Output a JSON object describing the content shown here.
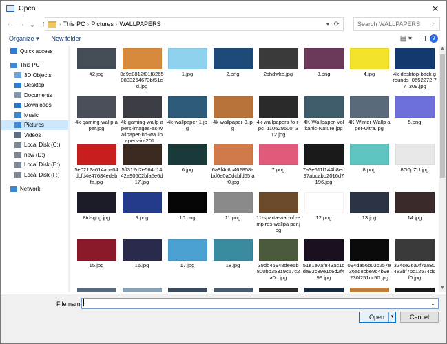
{
  "window": {
    "title": "Open",
    "close_glyph": "✕"
  },
  "nav": {
    "back": "←",
    "forward": "→",
    "recent": "⌄",
    "up": "↑"
  },
  "breadcrumb": [
    "This PC",
    "Pictures",
    "WALLPAPERS"
  ],
  "breadcrumb_sep": "›",
  "search": {
    "placeholder": "Search WALLPAPERS"
  },
  "toolbar": {
    "organize": "Organize ▾",
    "new_folder": "New folder",
    "view_glyph": "▤ ▾",
    "help_glyph": "?"
  },
  "sidebar": [
    {
      "label": "Quick access",
      "icon": "star-icon",
      "color": "#2f7bd4"
    },
    {
      "label": "This PC",
      "icon": "computer-icon",
      "color": "#3c8ad8",
      "gap": true
    },
    {
      "label": "3D Objects",
      "icon": "cube-icon",
      "color": "#66a6e2",
      "indent": true
    },
    {
      "label": "Desktop",
      "icon": "desktop-icon",
      "color": "#2c7fd0",
      "indent": true
    },
    {
      "label": "Documents",
      "icon": "document-icon",
      "color": "#7f96ad",
      "indent": true
    },
    {
      "label": "Downloads",
      "icon": "download-icon",
      "color": "#2a73c8",
      "indent": true
    },
    {
      "label": "Music",
      "icon": "music-icon",
      "color": "#3a86d0",
      "indent": true
    },
    {
      "label": "Pictures",
      "icon": "picture-icon",
      "color": "#3c8ad8",
      "indent": true,
      "selected": true
    },
    {
      "label": "Videos",
      "icon": "video-icon",
      "color": "#5a6f86",
      "indent": true
    },
    {
      "label": "Local Disk (C:)",
      "icon": "drive-icon",
      "color": "#7d8896",
      "indent": true
    },
    {
      "label": "new  (D:)",
      "icon": "drive-icon",
      "color": "#7d8896",
      "indent": true
    },
    {
      "label": "Local Disk (E:)",
      "icon": "drive-icon",
      "color": "#7d8896",
      "indent": true
    },
    {
      "label": "Local Disk (F:)",
      "icon": "drive-icon",
      "color": "#7d8896",
      "indent": true
    },
    {
      "label": "Network",
      "icon": "network-icon",
      "color": "#3a86d0",
      "gap": true
    }
  ],
  "files": [
    {
      "name": "#2.jpg",
      "thumb": "#444c56"
    },
    {
      "name": "0e9e8812f01f8265 0833264673bf51e d.jpg",
      "thumb": "#d88a3c"
    },
    {
      "name": "1.jpg",
      "thumb": "#8fd2ee"
    },
    {
      "name": "2.png",
      "thumb": "#1e4a7a"
    },
    {
      "name": "2shdwke.jpg",
      "thumb": "#3a3a3a"
    },
    {
      "name": "3.png",
      "thumb": "#6b3a5a"
    },
    {
      "name": "4.jpg",
      "thumb": "#f4e12a"
    },
    {
      "name": "4k-desktop-back grounds_0652272 77_309.jpg",
      "thumb": "#123a6e"
    },
    {
      "name": "4k-gaming-wallp aper.jpg",
      "thumb": "#4a4f58"
    },
    {
      "name": "4k-gaming-wallp apers-images-as-wallpaper-hd-wa llpapers-in-201...",
      "thumb": "#3b3e44"
    },
    {
      "name": "4k-wallpaper-1.jp g",
      "thumb": "#2d5a78"
    },
    {
      "name": "4k-wallpaper-3.jp g",
      "thumb": "#b8733a"
    },
    {
      "name": "4k-wallpapers-fo r-pc_110629600_3 12.jpg",
      "thumb": "#2a2a2a"
    },
    {
      "name": "4K-Wallpaper-Vol kanic-Nature.jpg",
      "thumb": "#3e5c6a"
    },
    {
      "name": "4K-Winter-Wallp aper-Ultra.jpg",
      "thumb": "#5a6a7a"
    },
    {
      "name": "5.png",
      "thumb": "#6f6fdc"
    },
    {
      "name": "5e0212a614aba04 dcfd4e47684edeb fa.jpg",
      "thumb": "#c81e1e"
    },
    {
      "name": "5ff312d2e564b14 42a90602bfa5e6d 17.jpg",
      "thumb": "#3a2a20"
    },
    {
      "name": "6.jpg",
      "thumb": "#1a3a3a"
    },
    {
      "name": "6a9f4c6b462858a bd0e0a0dcbfd65 af0.jpg",
      "thumb": "#d07a4a"
    },
    {
      "name": "7.png",
      "thumb": "#e05a7a"
    },
    {
      "name": "7a3e611f144b8ed 97abcabb2016d7 196.jpg",
      "thumb": "#1a1a1a"
    },
    {
      "name": "8.png",
      "thumb": "#5ec4c0"
    },
    {
      "name": "8O0pZU.jpg",
      "thumb": "#e8e8e8"
    },
    {
      "name": "8tdsgbg.jpg",
      "thumb": "#1c1c28"
    },
    {
      "name": "9.png",
      "thumb": "#243a8a"
    },
    {
      "name": "10.png",
      "thumb": "#050505"
    },
    {
      "name": "11.png",
      "thumb": "#8a8a8a"
    },
    {
      "name": "11-sparta-war-of -empires-wallpa per.jpg",
      "thumb": "#6a4a2a"
    },
    {
      "name": "12.png",
      "thumb": "#ffffff"
    },
    {
      "name": "13.jpg",
      "thumb": "#2a3444"
    },
    {
      "name": "14.jpg",
      "thumb": "#3a2a2a"
    },
    {
      "name": "15.jpg",
      "thumb": "#8a1a2a"
    },
    {
      "name": "16.jpg",
      "thumb": "#2a2a4a"
    },
    {
      "name": "17.jpg",
      "thumb": "#4aa0d0"
    },
    {
      "name": "18.jpg",
      "thumb": "#3a8aa0"
    },
    {
      "name": "39db46948dee5b 800bb35319c57c2 a0d.jpg",
      "thumb": "#4a5a3a"
    },
    {
      "name": "51e1e7af843ac1c da93c39e1c6d2f4 99.jpg",
      "thumb": "#1a1020"
    },
    {
      "name": "094da56b03c257e 36ad8cbe964b9e 230f251cc50.jpg",
      "thumb": "#0a0a0a"
    },
    {
      "name": "324ce26a7f7a880 483bf7bc12574d6 f0.jpg",
      "thumb": "#3a3a3a"
    },
    {
      "name": "",
      "thumb": "#5a6a7a"
    },
    {
      "name": "",
      "thumb": "#8aa0b0"
    },
    {
      "name": "",
      "thumb": "#3a4a5a"
    },
    {
      "name": "",
      "thumb": "#4a5a6a"
    },
    {
      "name": "",
      "thumb": "#2a2a2a"
    },
    {
      "name": "",
      "thumb": "#1a2a3a"
    },
    {
      "name": "",
      "thumb": "#c08040"
    },
    {
      "name": "",
      "thumb": "#1a1a1a"
    }
  ],
  "filename": {
    "label": "File name:",
    "value": ""
  },
  "buttons": {
    "open": "Open",
    "cancel": "Cancel"
  },
  "colors": {
    "accent": "#0078d7",
    "selected_bg": "#cce8ff"
  }
}
